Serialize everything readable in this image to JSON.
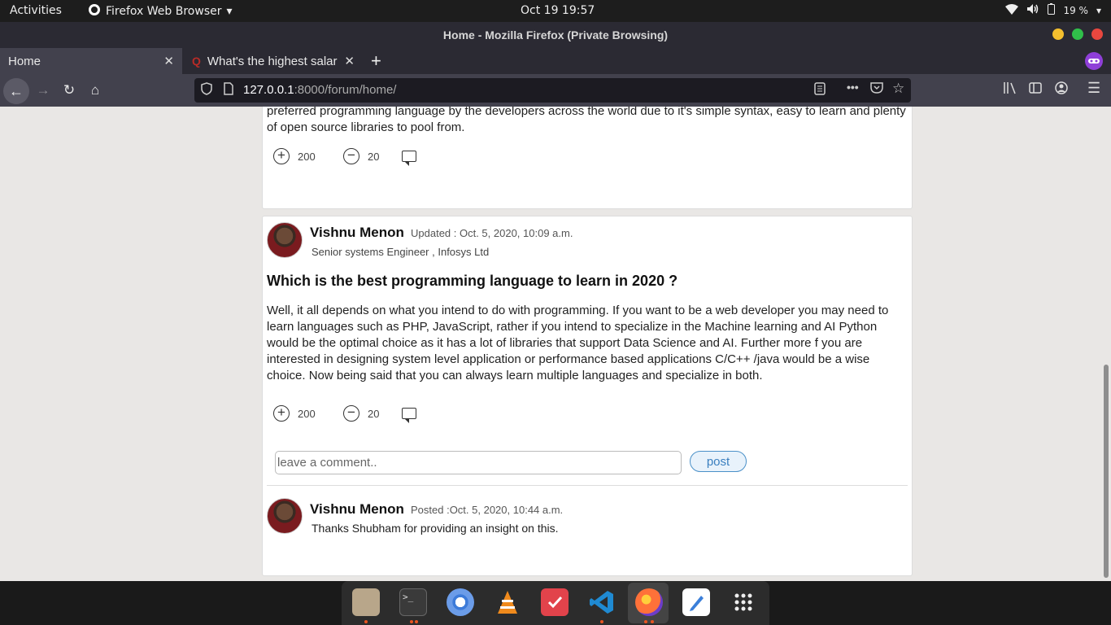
{
  "topbar": {
    "activities": "Activities",
    "app_name": "Firefox Web Browser",
    "clock": "Oct 19  19:57",
    "battery": "19 %"
  },
  "window": {
    "title": "Home - Mozilla Firefox (Private Browsing)"
  },
  "tabs": [
    {
      "label": "Home"
    },
    {
      "label": "What's the highest salar"
    }
  ],
  "nav": {
    "url_host": "127.0.0.1",
    "url_rest": ":8000/forum/home/"
  },
  "post1": {
    "body": "preferred programming language by the developers across the world due to it's simple syntax, easy to learn and plenty of open source libraries to pool from.",
    "upvotes": "200",
    "downvotes": "20"
  },
  "post2": {
    "author": "Vishnu Menon",
    "updated": "Updated : Oct. 5, 2020, 10:09 a.m.",
    "subtitle": "Senior systems Engineer , Infosys Ltd",
    "question": "Which is the best programming language to learn in 2020 ?",
    "body": "Well, it all depends on what you intend to do with programming. If you want to be a web developer you may need to learn languages such as PHP, JavaScript, rather if you intend to specialize in the Machine learning and AI Python would be the optimal choice as it has a lot of libraries that support Data Science and AI. Further more f you are interested in designing system level application or performance based applications C/C++ /java would be a wise choice. Now being said that you can always learn multiple languages and specialize in both.",
    "upvotes": "200",
    "downvotes": "20",
    "comment_placeholder": "leave a comment..",
    "post_label": "post",
    "comment": {
      "author": "Vishnu Menon",
      "posted": "Posted :Oct. 5, 2020, 10:44 a.m.",
      "text": "Thanks Shubham for providing an insight on this."
    }
  },
  "colors": {
    "topbar": "#1d1d1d",
    "firefox_chrome": "#2b2a33",
    "toolbar": "#42414d",
    "page_bg": "#e9e7e5",
    "accent_blue": "#3a7fbf",
    "ubuntu_orange": "#e95420"
  },
  "dock": {
    "apps": [
      "files-icon",
      "terminal-icon",
      "chromium-icon",
      "vlc-icon",
      "todo-icon",
      "vscode-icon",
      "firefox-icon",
      "text-editor-icon",
      "app-grid-icon"
    ]
  }
}
